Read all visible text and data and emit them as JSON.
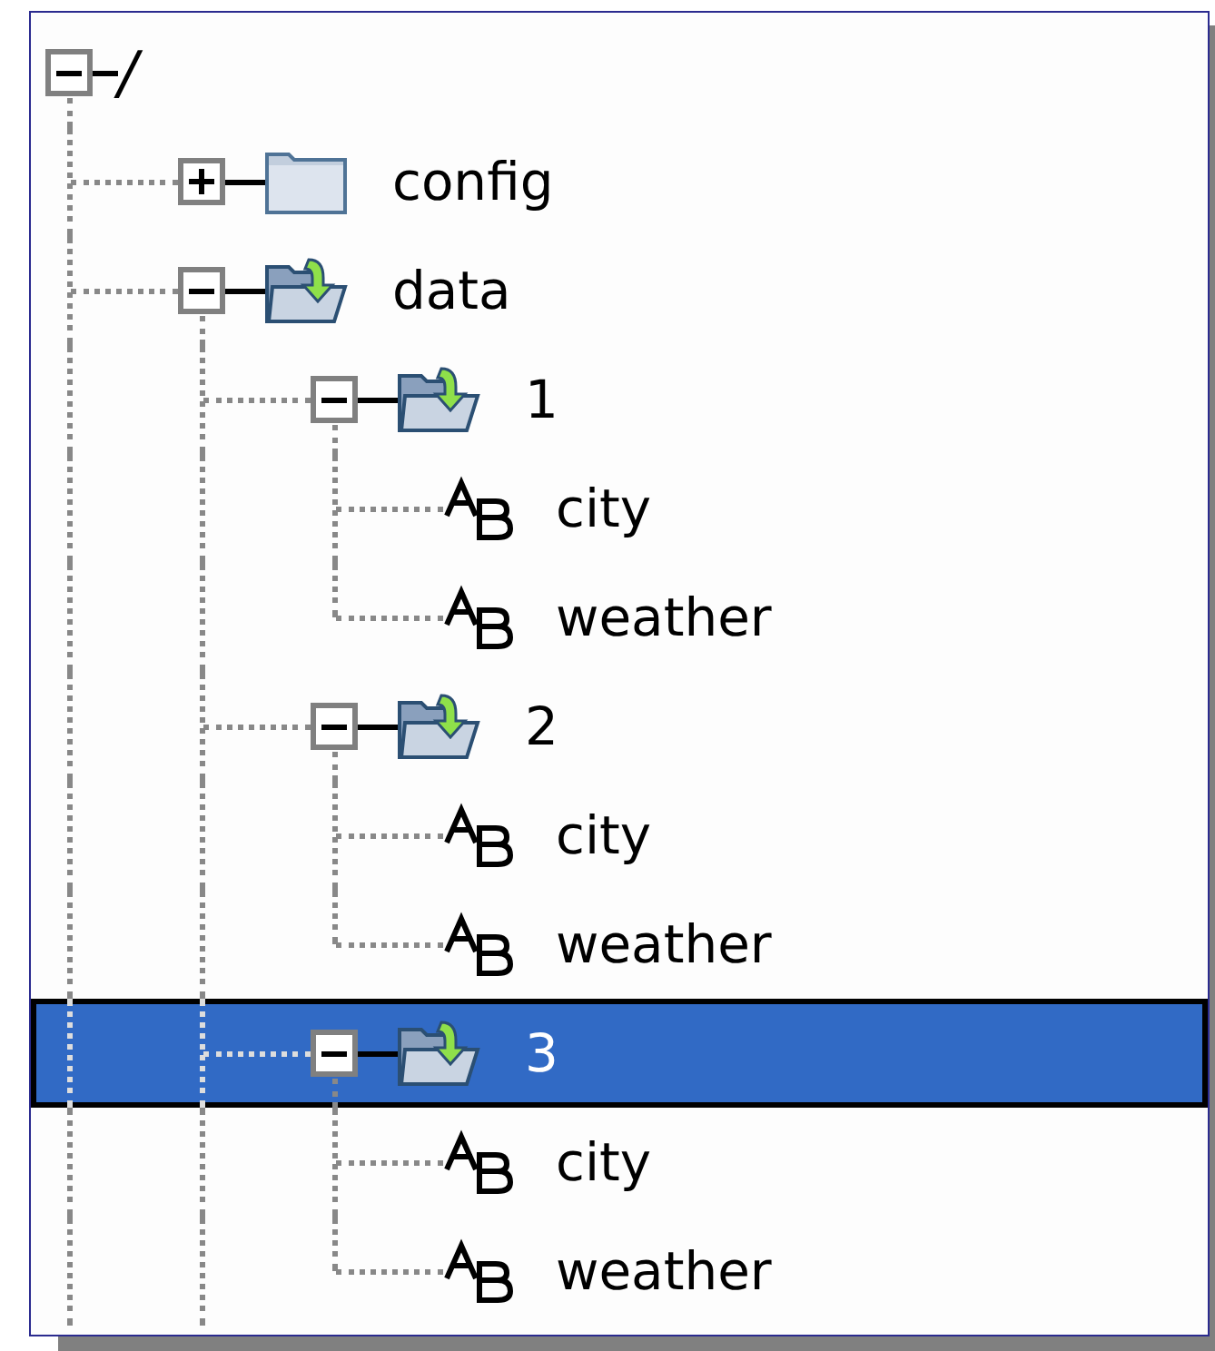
{
  "tree": {
    "label": "/",
    "kind": "root",
    "expanded": true,
    "more_below": true,
    "selected": false,
    "children": [
      {
        "label": "config",
        "kind": "folder",
        "expanded": false,
        "selected": false
      },
      {
        "label": "data",
        "kind": "folder",
        "expanded": true,
        "more_below": true,
        "selected": false,
        "children": [
          {
            "label": "1",
            "kind": "folder",
            "expanded": true,
            "selected": false,
            "children": [
              {
                "label": "city",
                "kind": "field",
                "selected": false
              },
              {
                "label": "weather",
                "kind": "field",
                "selected": false
              }
            ]
          },
          {
            "label": "2",
            "kind": "folder",
            "expanded": true,
            "selected": false,
            "children": [
              {
                "label": "city",
                "kind": "field",
                "selected": false
              },
              {
                "label": "weather",
                "kind": "field",
                "selected": false
              }
            ]
          },
          {
            "label": "3",
            "kind": "folder",
            "expanded": true,
            "selected": true,
            "children": [
              {
                "label": "city",
                "kind": "field",
                "selected": false
              },
              {
                "label": "weather",
                "kind": "field",
                "selected": false
              }
            ]
          }
        ]
      }
    ]
  }
}
